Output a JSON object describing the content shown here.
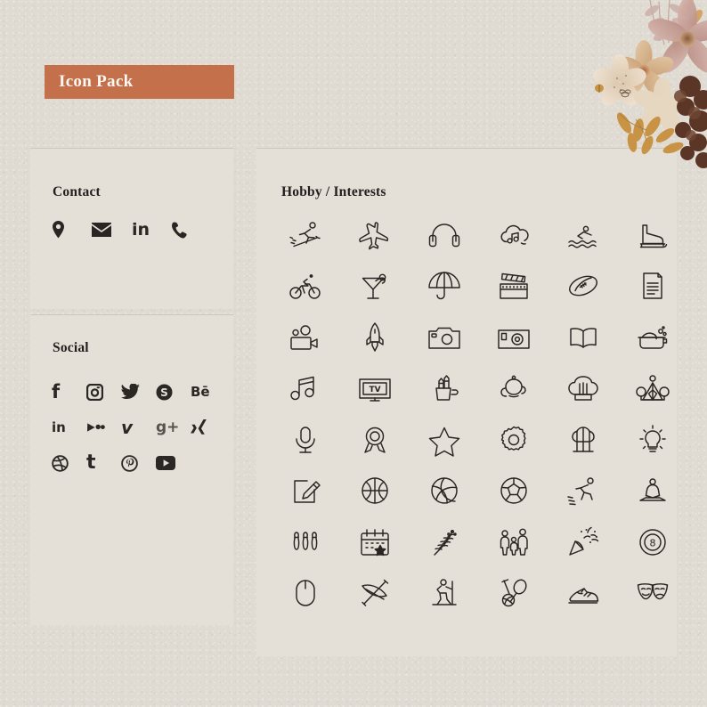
{
  "banner": {
    "label": "Icon Pack",
    "color": "#c4714b"
  },
  "background_color": "#e0dbd2",
  "panel_color": "#e4dfd7",
  "ink_color": "#2a2522",
  "contact": {
    "title": "Contact",
    "icons": [
      {
        "name": "location-pin-icon",
        "label": "Location"
      },
      {
        "name": "envelope-icon",
        "label": "Email"
      },
      {
        "name": "linkedin-icon",
        "label": "LinkedIn",
        "glyph": "in"
      },
      {
        "name": "phone-icon",
        "label": "Phone"
      }
    ]
  },
  "social": {
    "title": "Social",
    "icons": [
      {
        "name": "facebook-icon",
        "label": "Facebook",
        "glyph": "f"
      },
      {
        "name": "instagram-icon",
        "label": "Instagram"
      },
      {
        "name": "twitter-icon",
        "label": "Twitter"
      },
      {
        "name": "skype-icon",
        "label": "Skype",
        "glyph": "S"
      },
      {
        "name": "behance-icon",
        "label": "Behance",
        "glyph": "Bē"
      },
      {
        "name": "linkedin-icon",
        "label": "LinkedIn",
        "glyph": "in"
      },
      {
        "name": "bloglovin-icon",
        "label": "Bloglovin"
      },
      {
        "name": "vimeo-icon",
        "label": "Vimeo",
        "glyph": "v"
      },
      {
        "name": "google-plus-icon",
        "label": "Google Plus",
        "glyph": "g+"
      },
      {
        "name": "xing-icon",
        "label": "Xing",
        "glyph": "X"
      },
      {
        "name": "dribbble-icon",
        "label": "Dribbble"
      },
      {
        "name": "tumblr-icon",
        "label": "Tumblr",
        "glyph": "t"
      },
      {
        "name": "pinterest-icon",
        "label": "Pinterest"
      },
      {
        "name": "youtube-icon",
        "label": "YouTube"
      }
    ]
  },
  "hobby": {
    "title": "Hobby / Interests",
    "columns": 6,
    "rows": 8,
    "icons": [
      {
        "name": "skiing-icon",
        "label": "Skiing"
      },
      {
        "name": "airplane-icon",
        "label": "Travel / Airplane"
      },
      {
        "name": "headphones-icon",
        "label": "Headphones"
      },
      {
        "name": "music-cloud-icon",
        "label": "Music Cloud"
      },
      {
        "name": "swimming-icon",
        "label": "Swimming"
      },
      {
        "name": "ice-skate-icon",
        "label": "Ice Skating"
      },
      {
        "name": "cycling-icon",
        "label": "Cycling"
      },
      {
        "name": "cocktail-icon",
        "label": "Cocktail"
      },
      {
        "name": "umbrella-icon",
        "label": "Umbrella"
      },
      {
        "name": "clapperboard-icon",
        "label": "Movies / Clapperboard"
      },
      {
        "name": "football-icon",
        "label": "American Football"
      },
      {
        "name": "book-page-icon",
        "label": "Reading / Document"
      },
      {
        "name": "video-camera-icon",
        "label": "Video Camera"
      },
      {
        "name": "rocket-icon",
        "label": "Rocket"
      },
      {
        "name": "camera-icon",
        "label": "Photography"
      },
      {
        "name": "camera-alt-icon",
        "label": "Camera"
      },
      {
        "name": "open-book-icon",
        "label": "Open Book"
      },
      {
        "name": "cooking-pot-icon",
        "label": "Cooking"
      },
      {
        "name": "music-note-icon",
        "label": "Music"
      },
      {
        "name": "tv-icon",
        "label": "Television"
      },
      {
        "name": "brush-cup-icon",
        "label": "Painting / Brushes"
      },
      {
        "name": "teapot-icon",
        "label": "Tea"
      },
      {
        "name": "chef-hat-icon",
        "label": "Cooking / Chef Hat"
      },
      {
        "name": "camping-tent-icon",
        "label": "Camping"
      },
      {
        "name": "microphone-icon",
        "label": "Singing / Microphone"
      },
      {
        "name": "award-medal-icon",
        "label": "Award"
      },
      {
        "name": "star-icon",
        "label": "Star"
      },
      {
        "name": "gear-icon",
        "label": "Settings / Gear"
      },
      {
        "name": "forest-trees-icon",
        "label": "Nature / Trees"
      },
      {
        "name": "light-bulb-icon",
        "label": "Ideas / Light Bulb"
      },
      {
        "name": "writing-icon",
        "label": "Writing"
      },
      {
        "name": "basketball-icon",
        "label": "Basketball"
      },
      {
        "name": "volleyball-icon",
        "label": "Volleyball"
      },
      {
        "name": "soccer-ball-icon",
        "label": "Soccer"
      },
      {
        "name": "running-icon",
        "label": "Running"
      },
      {
        "name": "yoga-icon",
        "label": "Yoga / Meditation"
      },
      {
        "name": "bowling-pins-icon",
        "label": "Bowling"
      },
      {
        "name": "calendar-star-icon",
        "label": "Events / Calendar"
      },
      {
        "name": "lavender-icon",
        "label": "Gardening / Flowers"
      },
      {
        "name": "family-icon",
        "label": "Family"
      },
      {
        "name": "party-popper-icon",
        "label": "Party"
      },
      {
        "name": "billiard-ball-icon",
        "label": "Billiards"
      },
      {
        "name": "computer-mouse-icon",
        "label": "Computers / Gaming"
      },
      {
        "name": "kayak-icon",
        "label": "Kayaking"
      },
      {
        "name": "hiking-icon",
        "label": "Hiking"
      },
      {
        "name": "sports-gear-icon",
        "label": "Sports Equipment"
      },
      {
        "name": "sneaker-icon",
        "label": "Sneakers / Fitness"
      },
      {
        "name": "theater-masks-icon",
        "label": "Theater"
      }
    ]
  },
  "decoration": {
    "name": "floral-corner-decoration",
    "label": "Dried flower arrangement"
  }
}
